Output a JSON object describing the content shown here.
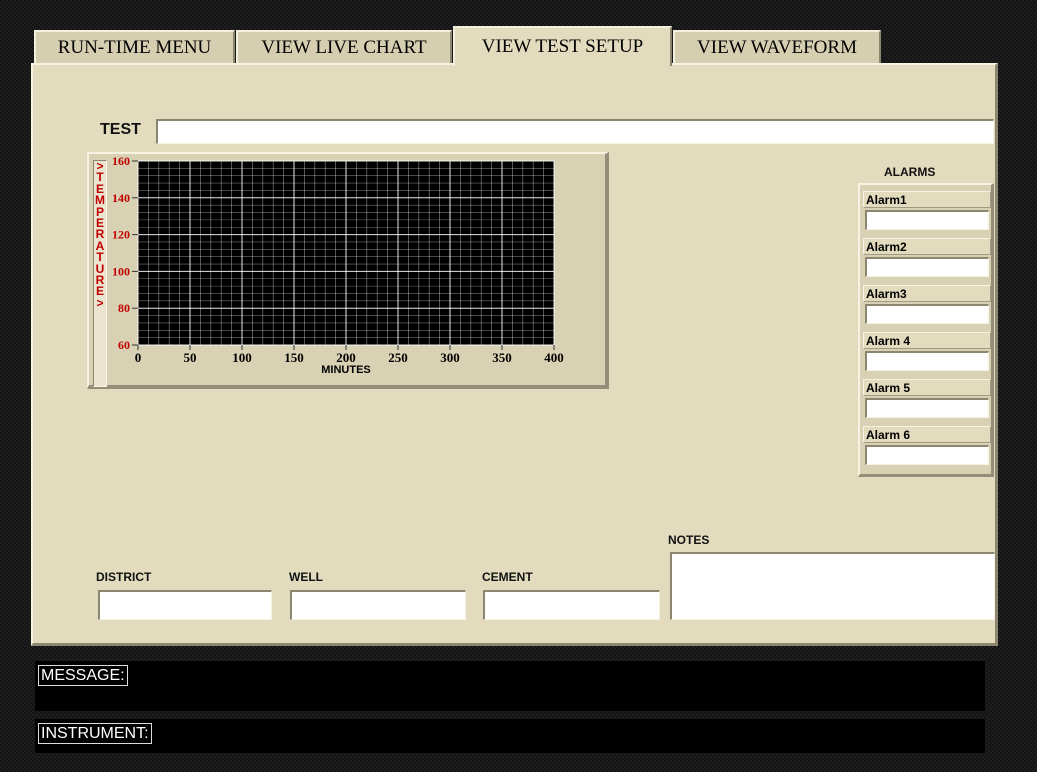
{
  "tabs": [
    {
      "label": "RUN-TIME MENU",
      "active": false
    },
    {
      "label": "VIEW LIVE CHART",
      "active": false
    },
    {
      "label": "VIEW TEST SETUP",
      "active": true
    },
    {
      "label": "VIEW WAVEFORM",
      "active": false
    }
  ],
  "test": {
    "label": "TEST",
    "value": ""
  },
  "chart_data": {
    "type": "line",
    "title": "",
    "xlabel": "MINUTES",
    "ylabel": ">TEMPERATURE>",
    "xlim": [
      0,
      400
    ],
    "ylim": [
      60,
      160
    ],
    "x_ticks": [
      "0",
      "50",
      "100",
      "150",
      "200",
      "250",
      "300",
      "350",
      "400"
    ],
    "y_ticks": [
      "160",
      "140",
      "120",
      "100",
      "80",
      "60"
    ],
    "grid": true,
    "background": "#000000",
    "series": []
  },
  "alarms": {
    "title": "ALARMS",
    "items": [
      {
        "label": "Alarm1",
        "value": ""
      },
      {
        "label": "Alarm2",
        "value": ""
      },
      {
        "label": "Alarm3",
        "value": ""
      },
      {
        "label": "Alarm 4",
        "value": ""
      },
      {
        "label": "Alarm 5",
        "value": ""
      },
      {
        "label": "Alarm 6",
        "value": ""
      }
    ]
  },
  "fields": {
    "district": {
      "label": "DISTRICT",
      "value": ""
    },
    "well": {
      "label": "WELL",
      "value": ""
    },
    "cement": {
      "label": "CEMENT",
      "value": ""
    },
    "notes": {
      "label": "NOTES",
      "value": ""
    }
  },
  "status": {
    "message_label": "MESSAGE:",
    "message_value": "",
    "instrument_label": "INSTRUMENT:",
    "instrument_value": ""
  },
  "colors": {
    "panel": "#e2dbbe",
    "axis_labels": "#c00000",
    "plot_background": "#000000",
    "grid": "#ffffff"
  }
}
